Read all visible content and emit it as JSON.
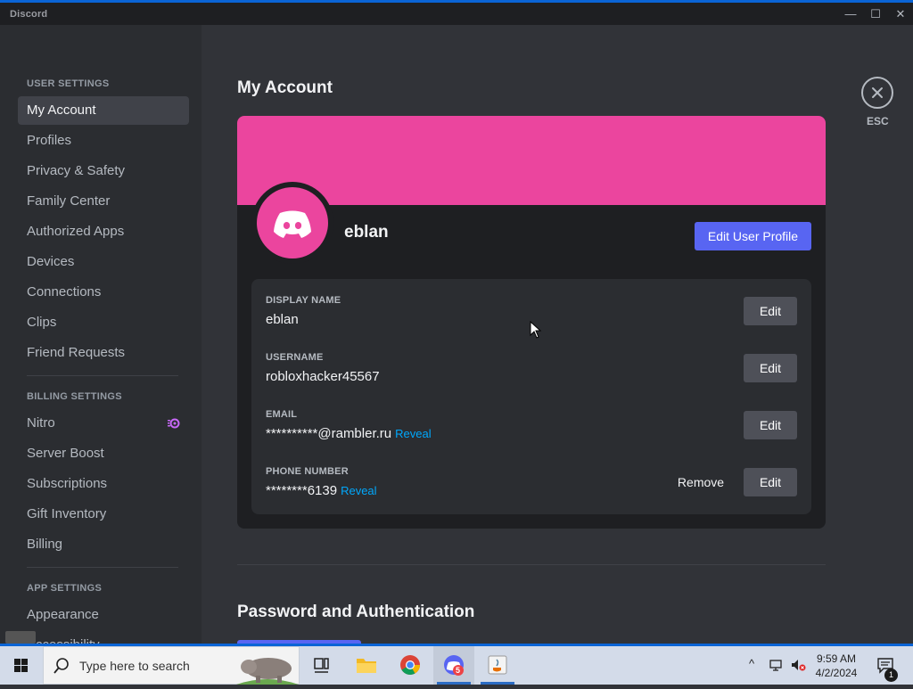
{
  "app": {
    "title": "Discord"
  },
  "window_controls": {
    "minimize": "—",
    "maximize": "☐",
    "close": "✕"
  },
  "sidebar": {
    "user_settings_header": "USER SETTINGS",
    "user_items": [
      "My Account",
      "Profiles",
      "Privacy & Safety",
      "Family Center",
      "Authorized Apps",
      "Devices",
      "Connections",
      "Clips",
      "Friend Requests"
    ],
    "billing_settings_header": "BILLING SETTINGS",
    "billing_items": [
      "Nitro",
      "Server Boost",
      "Subscriptions",
      "Gift Inventory",
      "Billing"
    ],
    "app_settings_header": "APP SETTINGS",
    "app_items": [
      "Appearance",
      "Accessibility"
    ],
    "active_item": "My Account"
  },
  "main": {
    "title": "My Account",
    "esc_label": "ESC",
    "profile": {
      "username": "eblan",
      "edit_profile_button": "Edit User Profile",
      "banner_color": "#eb459e"
    },
    "fields": [
      {
        "label": "DISPLAY NAME",
        "value": "eblan",
        "reveal": "",
        "edit": "Edit",
        "remove": ""
      },
      {
        "label": "USERNAME",
        "value": "robloxhacker45567",
        "reveal": "",
        "edit": "Edit",
        "remove": ""
      },
      {
        "label": "EMAIL",
        "value": "**********@rambler.ru",
        "reveal": "Reveal",
        "edit": "Edit",
        "remove": ""
      },
      {
        "label": "PHONE NUMBER",
        "value": "********6139",
        "reveal": "Reveal",
        "edit": "Edit",
        "remove": "Remove"
      }
    ],
    "password_section_title": "Password and Authentication"
  },
  "taskbar": {
    "search_placeholder": "Type here to search",
    "time": "9:59 AM",
    "date": "4/2/2024",
    "notification_count": "1",
    "discord_badge": "5"
  },
  "colors": {
    "accent": "#5865f2",
    "banner": "#eb459e",
    "link": "#00a8fc"
  }
}
